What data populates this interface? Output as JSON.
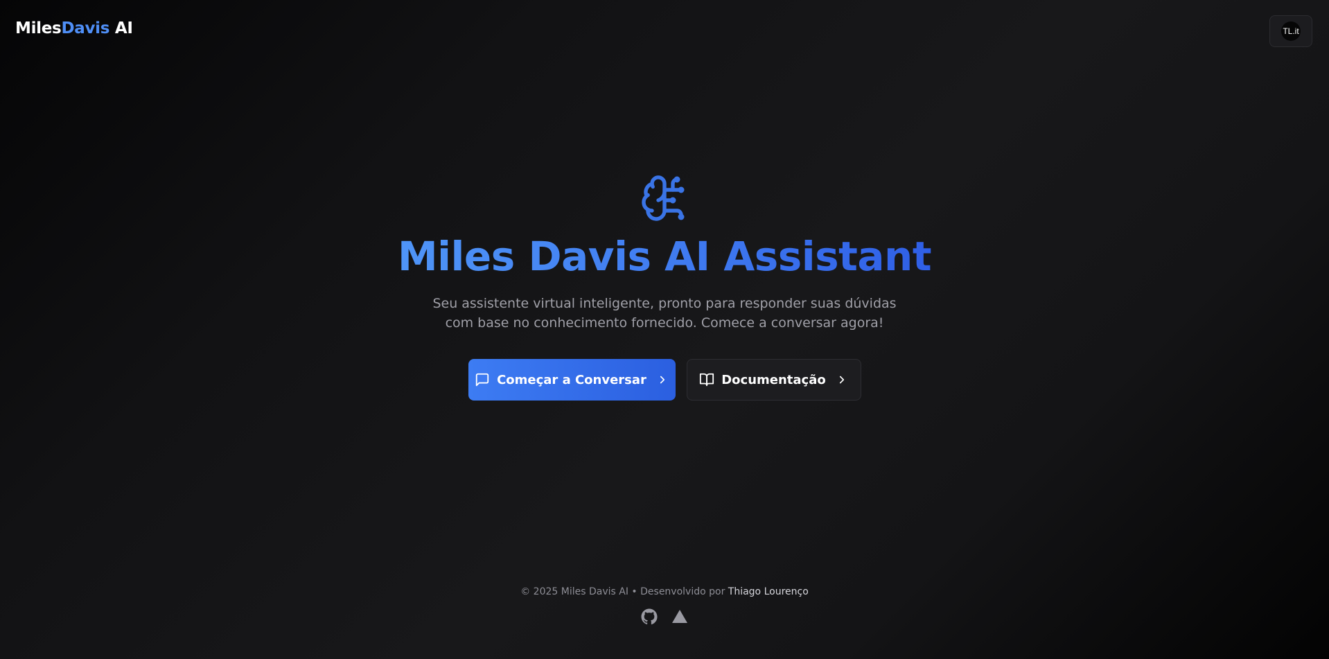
{
  "header": {
    "logo_part1": "Miles",
    "logo_part2": "Davis",
    "logo_part3": "AI",
    "avatar_text": "TL.it"
  },
  "hero": {
    "icon": "brain-circuit-icon",
    "title": "Miles Davis AI Assistant",
    "subtitle": "Seu assistente virtual inteligente, pronto para responder suas dúvidas com base no conhecimento fornecido. Comece a conversar agora!",
    "primary_button": {
      "label": "Começar a Conversar",
      "icon": "message-square-icon"
    },
    "secondary_button": {
      "label": "Documentação",
      "icon": "book-open-icon"
    }
  },
  "footer": {
    "copyright": "© 2025 Miles Davis AI",
    "separator": "•",
    "developed_by": "Desenvolvido por",
    "author": "Thiago Lourenço",
    "icons": [
      "github-icon",
      "vercel-icon"
    ]
  },
  "colors": {
    "accent": "#4f8ff7",
    "primary_button_start": "#3d7cf3",
    "primary_button_end": "#2b5fe0"
  }
}
